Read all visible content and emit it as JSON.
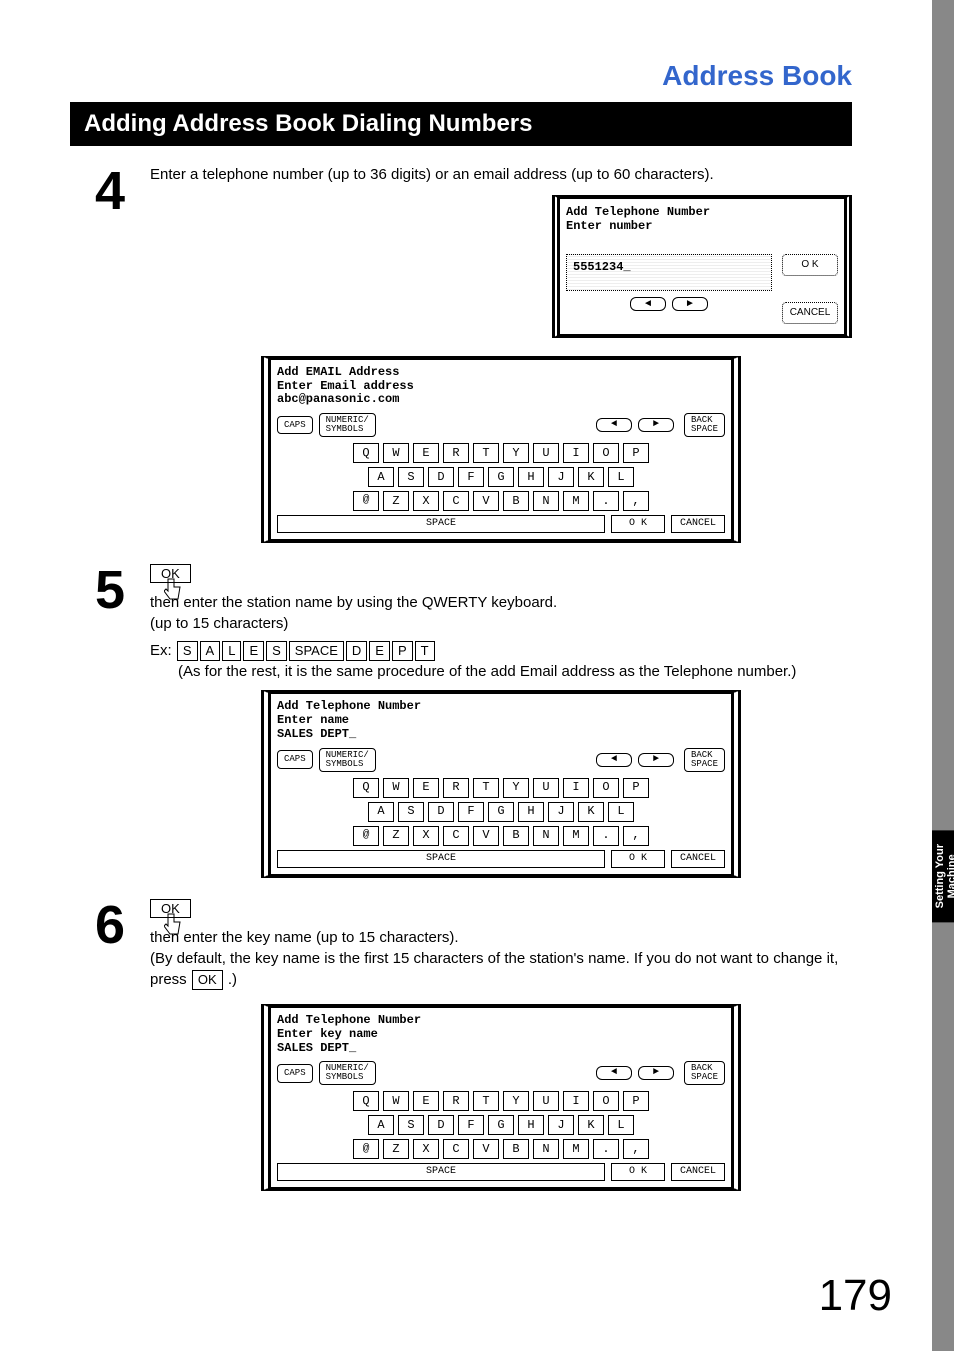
{
  "header": {
    "title": "Address Book"
  },
  "section": {
    "title": "Adding Address Book Dialing Numbers"
  },
  "sidebar": {
    "tab": "Setting Your\nMachine"
  },
  "page_number": "179",
  "common": {
    "caps": "CAPS",
    "numeric": "NUMERIC/\nSYMBOLS",
    "backspace": "BACK\nSPACE",
    "space": "SPACE",
    "ok": "OK",
    "cancel": "CANCEL",
    "left": "◄",
    "right": "►",
    "ok_small": "O K",
    "at": "@"
  },
  "keyboard_rows": {
    "r1": [
      "Q",
      "W",
      "E",
      "R",
      "T",
      "Y",
      "U",
      "I",
      "O",
      "P"
    ],
    "r2": [
      "A",
      "S",
      "D",
      "F",
      "G",
      "H",
      "J",
      "K",
      "L"
    ],
    "r3": [
      "@",
      "Z",
      "X",
      "C",
      "V",
      "B",
      "N",
      "M",
      ".",
      ","
    ]
  },
  "step4": {
    "num": "4",
    "text": "Enter a telephone number (up to 36 digits) or an email address (up to 60 characters).",
    "screen_num": {
      "line1": "Add Telephone Number",
      "line2": "Enter number",
      "input": "5551234_"
    },
    "screen_email": {
      "line1": "Add EMAIL Address",
      "line2": "Enter Email address",
      "line3": "abc@panasonic.com"
    }
  },
  "step5": {
    "num": "5",
    "ok_label": "OK",
    "text1": "then enter the station name by using the QWERTY keyboard.",
    "text2": "(up to 15 characters)",
    "ex_prefix": "Ex:",
    "ex_keys": [
      "S",
      "A",
      "L",
      "E",
      "S",
      "SPACE",
      "D",
      "E",
      "P",
      "T"
    ],
    "note": "(As for the rest, it is the same procedure of the add Email address as the Telephone number.)",
    "screen": {
      "line1": "Add Telephone Number",
      "line2": "Enter name",
      "line3": "SALES DEPT_"
    }
  },
  "step6": {
    "num": "6",
    "ok_label": "OK",
    "text1": "then enter the key name (up to 15 characters).",
    "text2a": "(By default, the key name is the first 15 characters of the station's name.  If you do not want to change it, press ",
    "text2_ok": "OK",
    "text2b": ".)",
    "screen": {
      "line1": "Add Telephone Number",
      "line2": "Enter key name",
      "line3": "SALES DEPT_"
    }
  }
}
